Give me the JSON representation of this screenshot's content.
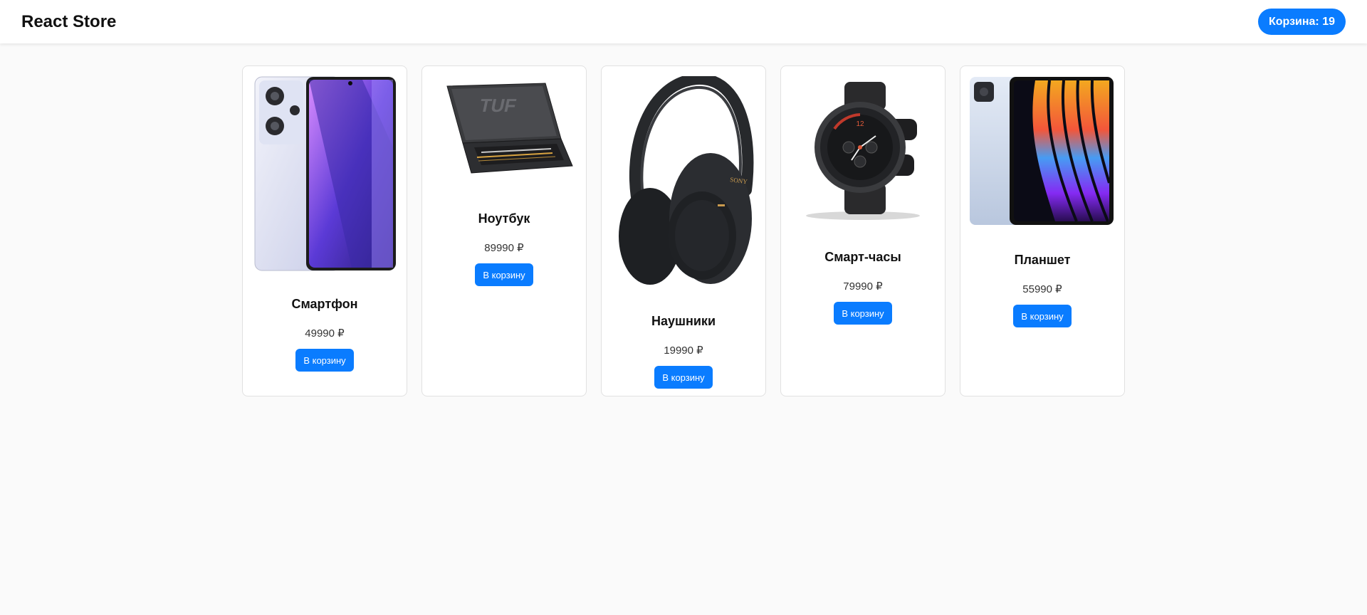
{
  "header": {
    "brand": "React Store",
    "cart_label": "Корзина: 19"
  },
  "colors": {
    "accent": "#0a7cff",
    "page_bg": "#fafafa",
    "card_bg": "#ffffff"
  },
  "products": [
    {
      "title": "Смартфон",
      "price": "49990 ₽",
      "button": "В корзину",
      "image_icon": "smartphone-image"
    },
    {
      "title": "Ноутбук",
      "price": "89990 ₽",
      "button": "В корзину",
      "image_icon": "laptop-image"
    },
    {
      "title": "Наушники",
      "price": "19990 ₽",
      "button": "В корзину",
      "image_icon": "headphones-image"
    },
    {
      "title": "Смарт-часы",
      "price": "79990 ₽",
      "button": "В корзину",
      "image_icon": "smartwatch-image"
    },
    {
      "title": "Планшет",
      "price": "55990 ₽",
      "button": "В корзину",
      "image_icon": "tablet-image"
    }
  ]
}
